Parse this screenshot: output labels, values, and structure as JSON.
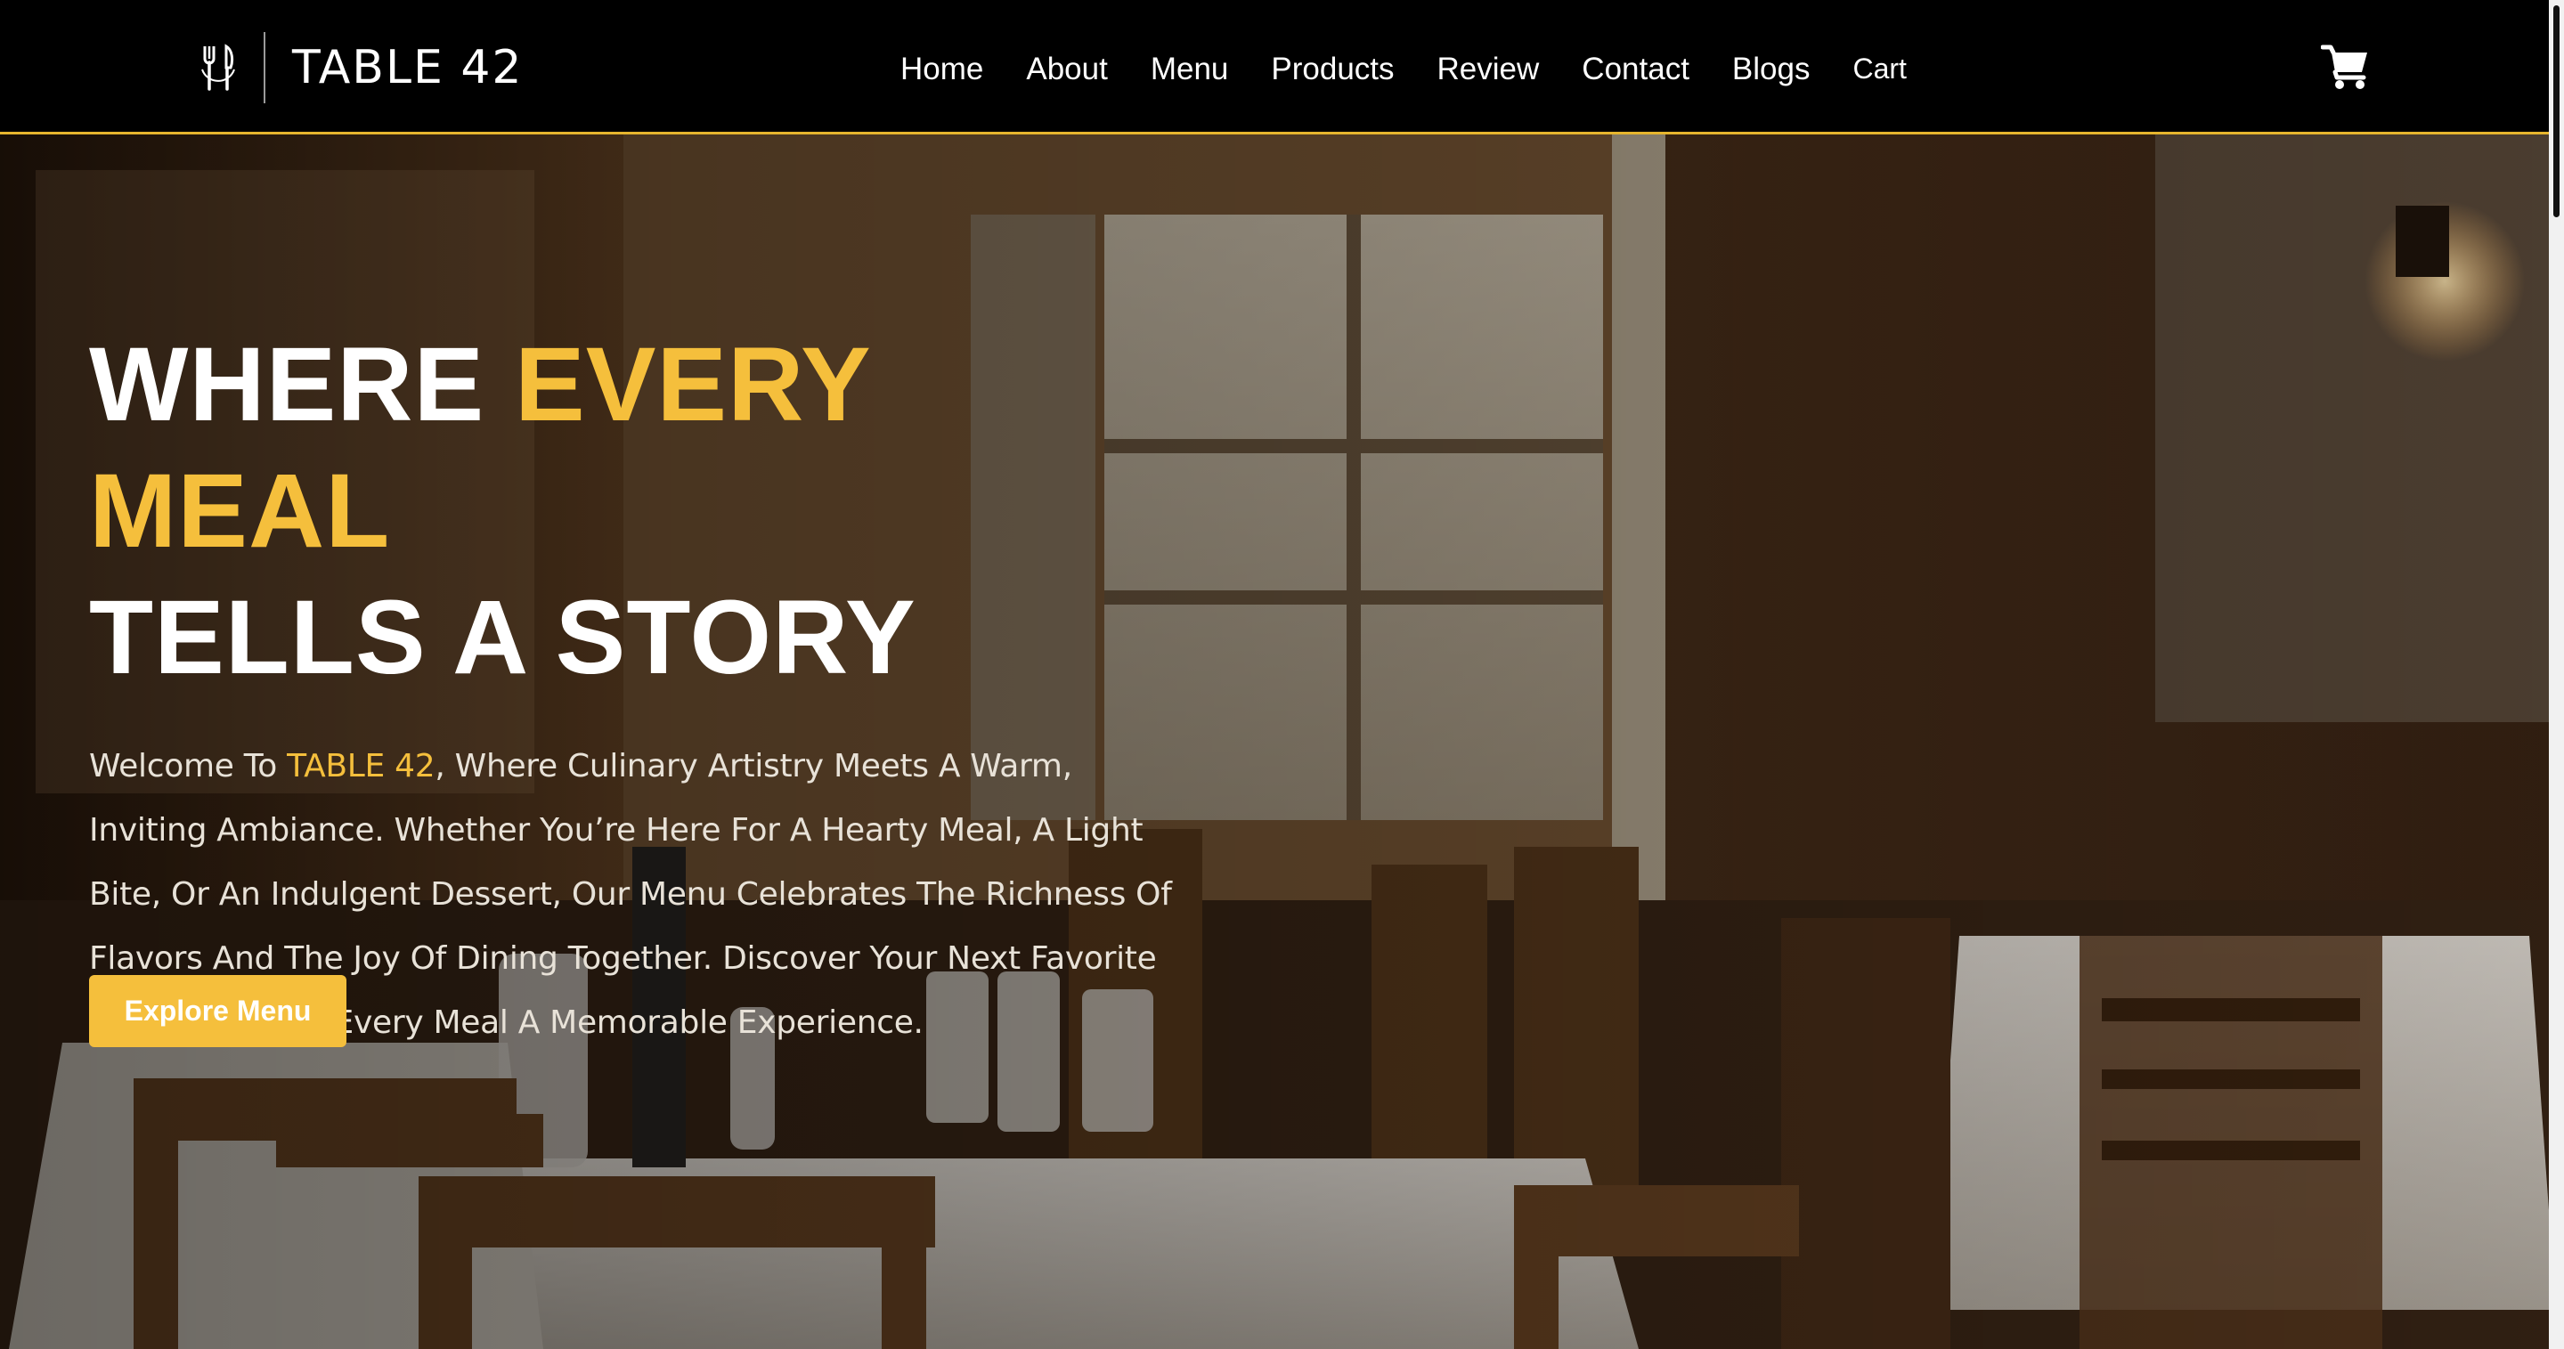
{
  "brand": {
    "icon": "fork-knife-icon",
    "name": "TABLE 42"
  },
  "nav": {
    "links": [
      "Home",
      "About",
      "Menu",
      "Products",
      "Review",
      "Contact",
      "Blogs",
      "Cart"
    ],
    "cart_icon": "shopping-cart-icon"
  },
  "hero": {
    "title_line1_white": "WHERE ",
    "title_line1_accent": "EVERY MEAL",
    "title_line2": "TELLS A STORY",
    "desc_before": "Welcome To ",
    "desc_brand": "TABLE 42",
    "desc_after": ", Where Culinary Artistry Meets A Warm, Inviting Ambiance. Whether You’re Here For A Hearty Meal, A Light Bite, Or An Indulgent Dessert, Our Menu Celebrates The Richness Of Flavors And The Joy Of Dining Together. Discover Your Next Favorite Dish And Make Every Meal A Memorable Experience.",
    "button_label": "Explore Menu",
    "background": "restaurant-interior-photo"
  },
  "colors": {
    "accent": "#f5bf3c",
    "navbar_bg": "#000000",
    "navbar_border": "#e6b52e",
    "text": "#ffffff"
  }
}
